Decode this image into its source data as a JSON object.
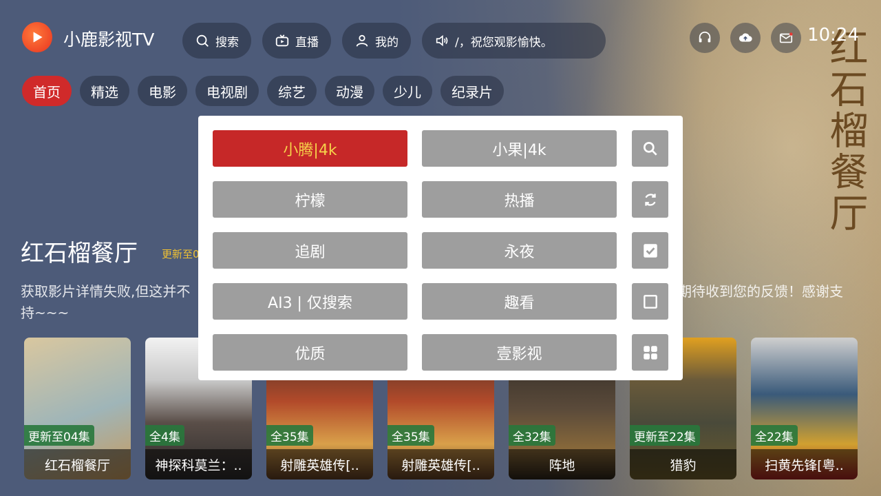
{
  "app": {
    "name": "小鹿影视TV",
    "time": "10:24"
  },
  "top_nav": {
    "search_label": "搜索",
    "live_label": "直播",
    "mine_label": "我的",
    "notice_text": "/，祝您观影愉快。"
  },
  "categories": [
    "首页",
    "精选",
    "电影",
    "电视剧",
    "综艺",
    "动漫",
    "少儿",
    "纪录片"
  ],
  "hero": {
    "title": "红石榴餐厅",
    "update_text": "更新至0",
    "description_left": "获取影片详情失败,但这并不",
    "description_right": "期待收到您的反馈！感谢支",
    "description_line2": "持~~~",
    "poster_text": "红石榴餐厅"
  },
  "source_popup": {
    "rows": [
      {
        "left": "小腾|4k",
        "right": "小果|4k",
        "side_icon": "search-icon"
      },
      {
        "left": "柠檬",
        "right": "热播",
        "side_icon": "refresh-icon"
      },
      {
        "left": "追剧",
        "right": "永夜",
        "side_icon": "checkbox-checked-icon"
      },
      {
        "left": "AI3 | 仅搜索",
        "right": "趣看",
        "side_icon": "checkbox-empty-icon"
      },
      {
        "left": "优质",
        "right": "壹影视",
        "side_icon": "grid-icon"
      }
    ],
    "selected": "小腾|4k"
  },
  "cards": [
    {
      "title": "红石榴餐厅",
      "badge": "更新至04集"
    },
    {
      "title": "神探科莫兰：..",
      "badge": "全4集"
    },
    {
      "title": "射雕英雄传[..",
      "badge": "全35集"
    },
    {
      "title": "射雕英雄传[..",
      "badge": "全35集"
    },
    {
      "title": "阵地",
      "badge": "全32集"
    },
    {
      "title": "猎豹",
      "badge": "更新至22集"
    },
    {
      "title": "扫黄先锋[粤..",
      "badge": "全22集"
    }
  ],
  "colors": {
    "accent": "#d02a2a",
    "selected_text": "#f6d24a",
    "button_gray": "#9e9e9e",
    "badge_green": "#28783c"
  }
}
